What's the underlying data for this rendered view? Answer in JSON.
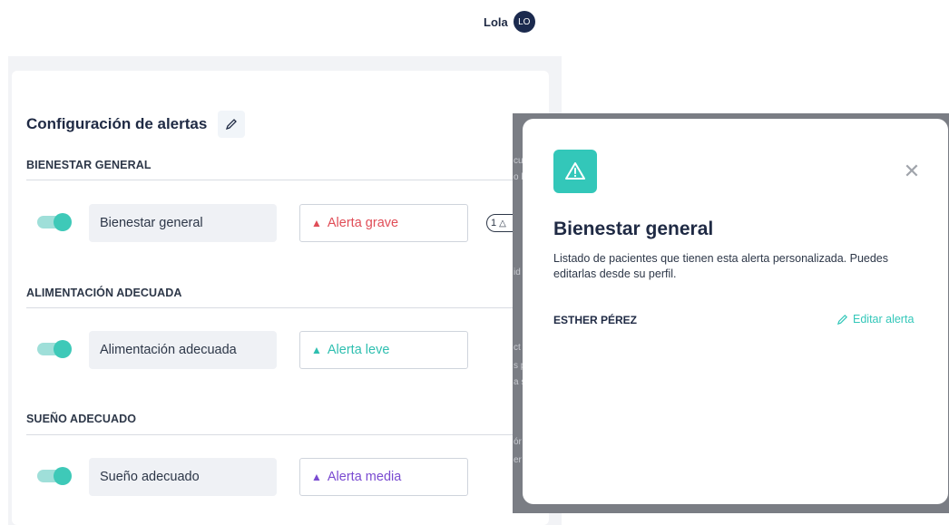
{
  "user": {
    "name": "Lola",
    "initials": "LO"
  },
  "panel": {
    "title": "Configuración de alertas",
    "sections": [
      {
        "header": "BIENESTAR GENERAL",
        "enabled": true,
        "item": "Bienestar general",
        "alert": "Alerta grave",
        "alert_color": "#e04d57",
        "count": "1"
      },
      {
        "header": "ALIMENTACIÓN ADECUADA",
        "enabled": true,
        "item": "Alimentación adecuada",
        "alert": "Alerta leve",
        "alert_color": "#2fbfb0"
      },
      {
        "header": "SUEÑO ADECUADO",
        "enabled": true,
        "item": "Sueño adecuado",
        "alert": "Alerta media",
        "alert_color": "#7a4bd1"
      }
    ]
  },
  "modal": {
    "title": "Bienestar general",
    "description": "Listado de pacientes que tienen esta alerta personalizada. Puedes editarlas desde su perfil.",
    "patients": [
      {
        "name": "ESTHER PÉREZ",
        "action": "Editar alerta"
      }
    ]
  },
  "colors": {
    "accent": "#33c7b9",
    "navy": "#1b2a4e"
  },
  "backdrop_snippets": [
    "cu",
    "o b",
    "id",
    "ct",
    "s p",
    "a s",
    "ór",
    "er"
  ]
}
